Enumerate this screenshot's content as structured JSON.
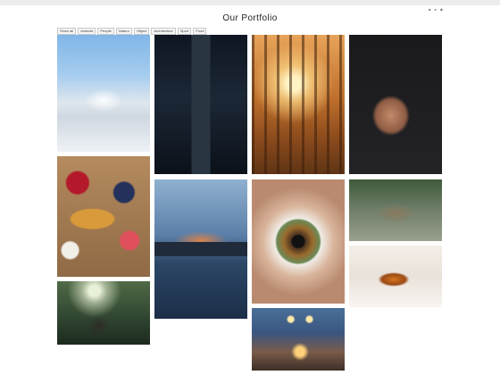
{
  "page": {
    "title": "Our Portfolio"
  },
  "social_icons": [
    "square-icon",
    "circle-icon",
    "dot-icon"
  ],
  "filters": [
    {
      "label": "Show all"
    },
    {
      "label": "Animals"
    },
    {
      "label": "People"
    },
    {
      "label": "Nature"
    },
    {
      "label": "Object"
    },
    {
      "label": "Architecture"
    },
    {
      "label": "Sport"
    },
    {
      "label": "Food"
    }
  ],
  "gallery": [
    {
      "subject": "snowboarder"
    },
    {
      "subject": "skyscraper"
    },
    {
      "subject": "autumn-forest"
    },
    {
      "subject": "woman-portrait"
    },
    {
      "subject": "breakfast"
    },
    {
      "subject": "mountain-lake"
    },
    {
      "subject": "eye"
    },
    {
      "subject": "mud-person"
    },
    {
      "subject": "elephant"
    },
    {
      "subject": "tiger"
    },
    {
      "subject": "street-lamps"
    }
  ]
}
